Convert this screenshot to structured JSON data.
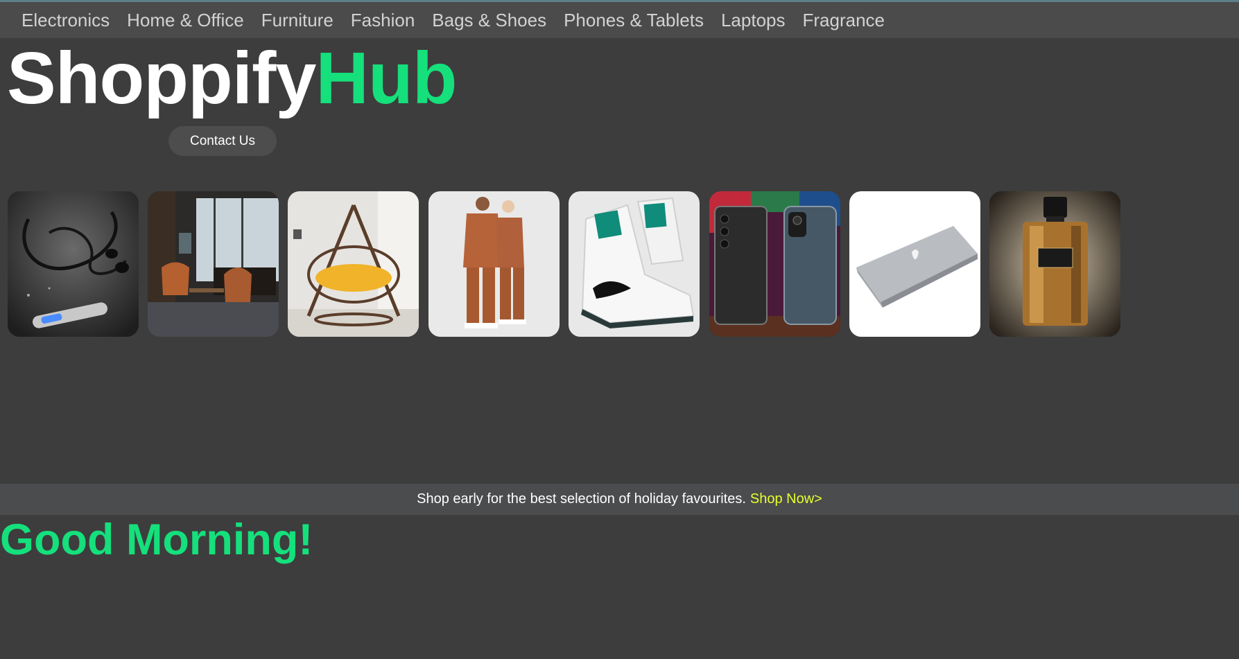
{
  "nav": {
    "items": [
      "Electronics",
      "Home & Office",
      "Furniture",
      "Fashion",
      "Bags & Shoes",
      "Phones & Tablets",
      "Laptops",
      "Fragrance"
    ]
  },
  "logo": {
    "part1": "Shoppify",
    "part2": "Hub"
  },
  "contact_button": "Contact Us",
  "categories": [
    "Electronics",
    "Home & Office",
    "Furniture",
    "Fashion",
    "Bags & Shoes",
    "Phones & Tablets",
    "Laptops",
    "Fragrance"
  ],
  "promo": {
    "text": "Shop early for the best selection of holiday favourites.",
    "link": "Shop Now>"
  },
  "greeting": "Good Morning!",
  "colors": {
    "background": "#3d3d3d",
    "accent": "#15e07c",
    "promo_link": "#e8ff2e"
  }
}
